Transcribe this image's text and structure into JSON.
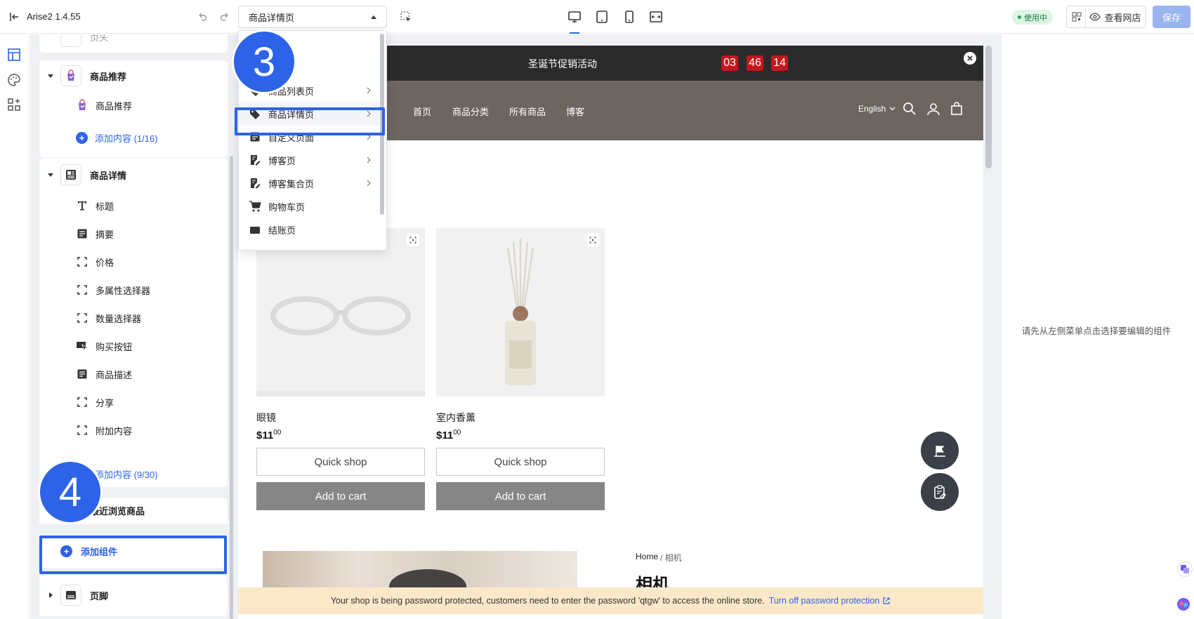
{
  "app": {
    "title": "Arise2 1.4.55"
  },
  "toolbar": {
    "page_select": "商品详情页",
    "badge": "使用中",
    "view_store": "查看网店",
    "save": "保存"
  },
  "dropdown": {
    "items": [
      {
        "label": "商品列表页",
        "icon": "tag-icon",
        "has_children": true
      },
      {
        "label": "商品详情页",
        "icon": "tag-icon",
        "has_children": true,
        "selected": true
      },
      {
        "label": "自定义页面",
        "icon": "document-icon",
        "has_children": true
      },
      {
        "label": "博客页",
        "icon": "edit-doc-icon",
        "has_children": true
      },
      {
        "label": "博客集合页",
        "icon": "edit-doc-icon",
        "has_children": true
      },
      {
        "label": "购物车页",
        "icon": "cart-icon",
        "has_children": false
      },
      {
        "label": "结账页",
        "icon": "wallet-icon",
        "has_children": false
      }
    ]
  },
  "sidebar": {
    "top_partial_label": "页头",
    "groups": [
      {
        "title": "商品推荐",
        "icon": "product-recommend-icon",
        "children": [
          {
            "label": "商品推荐",
            "icon": "product-recommend-icon"
          }
        ],
        "add_label": "添加内容 (1/16)"
      },
      {
        "title": "商品详情",
        "icon": "product-detail-icon",
        "children": [
          {
            "label": "标题",
            "icon": "text-icon"
          },
          {
            "label": "摘要",
            "icon": "document-icon"
          },
          {
            "label": "价格",
            "icon": "frame-icon"
          },
          {
            "label": "多属性选择器",
            "icon": "frame-icon"
          },
          {
            "label": "数量选择器",
            "icon": "frame-icon"
          },
          {
            "label": "购买按钮",
            "icon": "cursor-click-icon"
          },
          {
            "label": "商品描述",
            "icon": "document-icon"
          },
          {
            "label": "分享",
            "icon": "frame-icon"
          },
          {
            "label": "附加内容",
            "icon": "frame-icon"
          }
        ],
        "add_label": "添加内容 (9/30)"
      }
    ],
    "recent_label": "最近浏览商品",
    "add_component": "添加组件",
    "footer_label": "页脚"
  },
  "preview": {
    "promo_text": "圣诞节促销活动",
    "countdown": [
      "03",
      "46",
      "14"
    ],
    "nav": [
      "首页",
      "商品分类",
      "所有商品",
      "博客"
    ],
    "language": "English",
    "products": [
      {
        "name": "眼镜",
        "price_main": "$11",
        "price_cents": "00",
        "quick": "Quick shop",
        "add": "Add to cart"
      },
      {
        "name": "室内香薰",
        "price_main": "$11",
        "price_cents": "00",
        "quick": "Quick shop",
        "add": "Add to cart"
      }
    ],
    "breadcrumb_home": "Home",
    "breadcrumb_current": "/ 相机",
    "product_title": "相机",
    "password_notice": "Your shop is being password protected, customers need to enter the password 'qtgw' to access the online store.",
    "password_link": "Turn off password protection"
  },
  "right_panel": {
    "hint": "请先从左侧菜单点击选择要编辑的组件"
  },
  "steps": {
    "step3": "3",
    "step4": "4"
  },
  "colors": {
    "accent": "#2d63e6",
    "countdown": "#c4161c",
    "nav_bg": "#6c6560",
    "promo_bg": "#2b2b2b"
  }
}
